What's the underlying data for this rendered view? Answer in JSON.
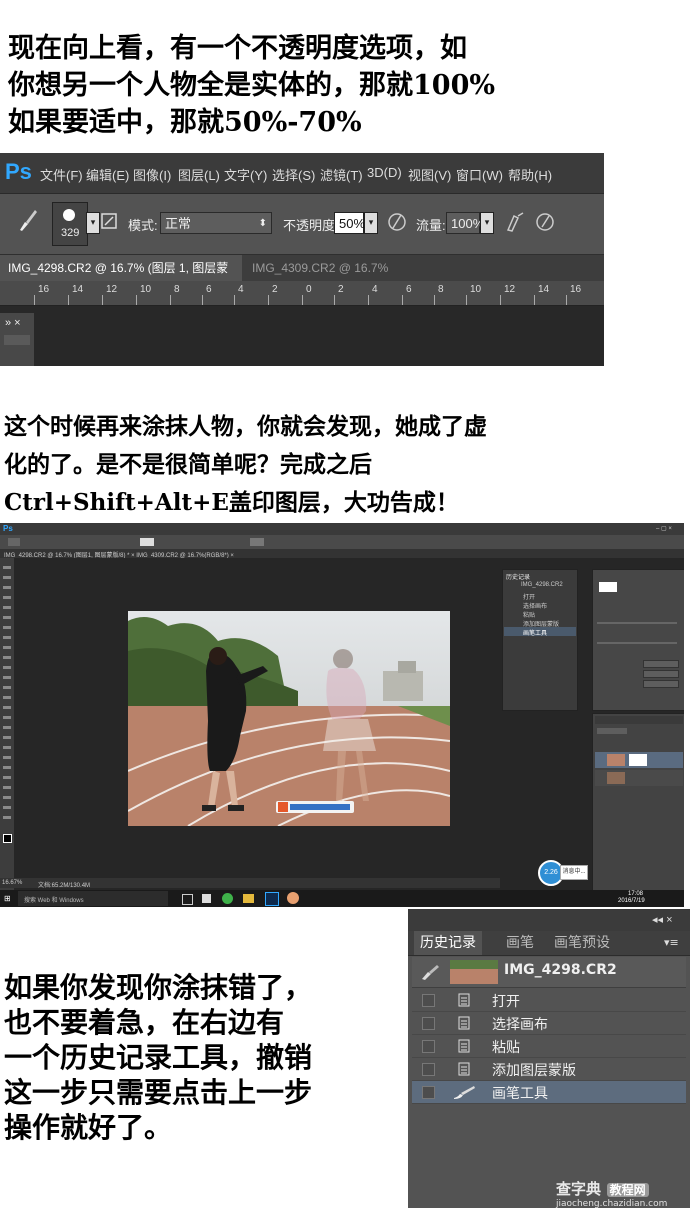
{
  "captions": {
    "top": "现在向上看，有一个不透明度选项，如\n你想另一个人物全是实体的，那就100%\n如果要适中，那就50%-70%",
    "middle": "这个时候再来涂抹人物，你就会发现，她成了虚\n化的了。是不是很简单呢？完成之后\nCtrl+Shift+Alt+E盖印图层，大功告成！",
    "bottom": "如果你发现你涂抹错了，\n也不要着急，在右边有\n一个历史记录工具，撤销\n这一步只需要点击上一步\n操作就好了。"
  },
  "ps_options": {
    "logo": "Ps",
    "menu": [
      "文件(F)",
      "编辑(E)",
      "图像(I)",
      "图层(L)",
      "文字(Y)",
      "选择(S)",
      "滤镜(T)",
      "3D(D)",
      "视图(V)",
      "窗口(W)",
      "帮助(H)"
    ],
    "brush_size": "329",
    "mode_label": "模式:",
    "mode_value": "正常",
    "opacity_label": "不透明度:",
    "opacity_value": "50%",
    "flow_label": "流量:",
    "flow_value": "100%",
    "tabs": [
      {
        "label": "IMG_4298.CR2 @ 16.7% (图层 1, 图层蒙版/8) *",
        "close": "×",
        "active": true
      },
      {
        "label": "IMG_4309.CR2 @ 16.7%(RGB/8*) *",
        "close": "×",
        "active": false
      }
    ],
    "ruler": [
      "16",
      "14",
      "12",
      "10",
      "8",
      "6",
      "4",
      "2",
      "0",
      "2",
      "4",
      "6",
      "8",
      "10",
      "12",
      "14",
      "16"
    ],
    "panel_collapse": "» ×"
  },
  "ps_full": {
    "logo": "Ps",
    "tab_label": "IMG_4298.CR2 @ 16.7% (图层1, 图层蒙版/8) * ×  IMG_4309.CR2 @ 16.7%(RGB/8*) ×",
    "history_items": [
      "IMG_4298.CR2",
      "打开",
      "选择画布",
      "粘贴",
      "添加图层蒙版",
      "画笔工具"
    ],
    "status_zoom": "16.67%",
    "status_doc": "文档:65.2M/130.4M",
    "taskbar_search": "搜索 Web 和 Windows",
    "clock_time": "17:08",
    "clock_date": "2016/7/19",
    "badge": "2.26",
    "badge_msg": "消息中..."
  },
  "history_panel": {
    "collapse": "◂◂ ×",
    "tabs": [
      "历史记录",
      "画笔",
      "画笔预设"
    ],
    "menu_icon": "▾≡",
    "snapshot_label": "IMG_4298.CR2",
    "items": [
      {
        "label": "打开",
        "icon": "document-icon",
        "selected": false
      },
      {
        "label": "选择画布",
        "icon": "document-icon",
        "selected": false
      },
      {
        "label": "粘贴",
        "icon": "document-icon",
        "selected": false
      },
      {
        "label": "添加图层蒙版",
        "icon": "document-icon",
        "selected": false
      },
      {
        "label": "画笔工具",
        "icon": "brush-icon",
        "selected": true
      }
    ]
  },
  "watermark": {
    "brand": "查字典",
    "tag": "教程网",
    "url": "jiaocheng.chazidian.com"
  }
}
